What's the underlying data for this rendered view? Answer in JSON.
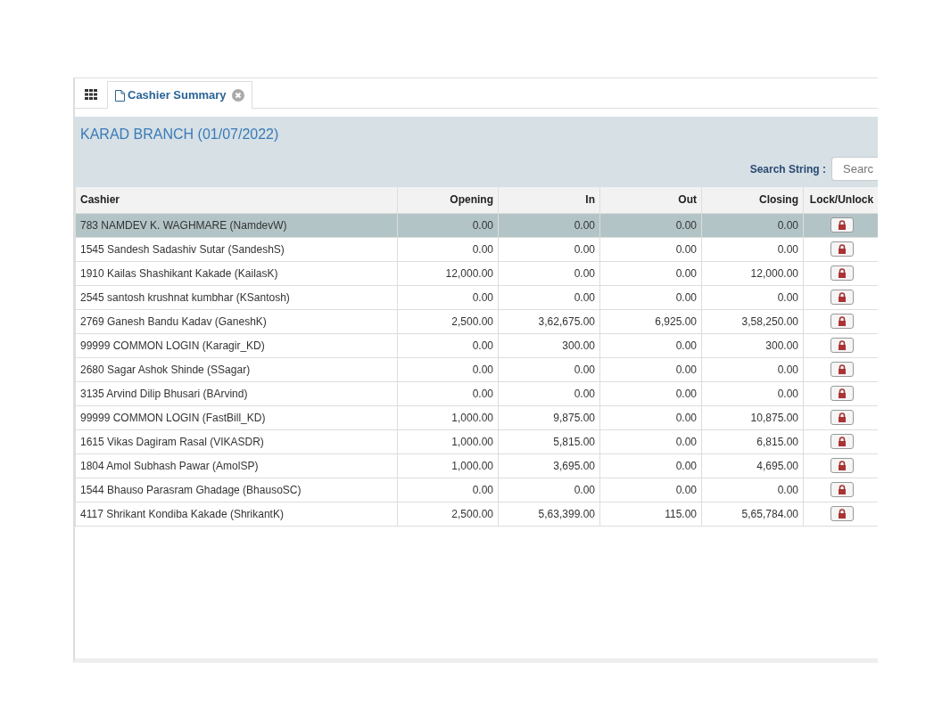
{
  "tabs": [
    {
      "label": "Cashier Summary",
      "selected": true
    }
  ],
  "title": "KARAD BRANCH (01/07/2022)",
  "search": {
    "label": "Search String :",
    "placeholder": "Searc"
  },
  "table": {
    "columns": [
      "Cashier",
      "Opening",
      "In",
      "Out",
      "Closing",
      "Lock/Unlock"
    ],
    "rows": [
      {
        "selected": true,
        "cells": [
          "783 NAMDEV K. WAGHMARE (NamdevW)",
          "0.00",
          "0.00",
          "0.00",
          "0.00"
        ]
      },
      {
        "selected": false,
        "cells": [
          "1545 Sandesh Sadashiv Sutar (SandeshS)",
          "0.00",
          "0.00",
          "0.00",
          "0.00"
        ]
      },
      {
        "selected": false,
        "cells": [
          "1910 Kailas Shashikant Kakade (KailasK)",
          "12,000.00",
          "0.00",
          "0.00",
          "12,000.00"
        ]
      },
      {
        "selected": false,
        "cells": [
          "2545 santosh krushnat kumbhar (KSantosh)",
          "0.00",
          "0.00",
          "0.00",
          "0.00"
        ]
      },
      {
        "selected": false,
        "cells": [
          "2769 Ganesh Bandu Kadav (GaneshK)",
          "2,500.00",
          "3,62,675.00",
          "6,925.00",
          "3,58,250.00"
        ]
      },
      {
        "selected": false,
        "cells": [
          "99999 COMMON LOGIN (Karagir_KD)",
          "0.00",
          "300.00",
          "0.00",
          "300.00"
        ]
      },
      {
        "selected": false,
        "cells": [
          "2680 Sagar Ashok Shinde (SSagar)",
          "0.00",
          "0.00",
          "0.00",
          "0.00"
        ]
      },
      {
        "selected": false,
        "cells": [
          "3135 Arvind Dilip Bhusari (BArvind)",
          "0.00",
          "0.00",
          "0.00",
          "0.00"
        ]
      },
      {
        "selected": false,
        "cells": [
          "99999 COMMON LOGIN (FastBill_KD)",
          "1,000.00",
          "9,875.00",
          "0.00",
          "10,875.00"
        ]
      },
      {
        "selected": false,
        "cells": [
          "1615 Vikas Dagiram Rasal (VIKASDR)",
          "1,000.00",
          "5,815.00",
          "0.00",
          "6,815.00"
        ]
      },
      {
        "selected": false,
        "cells": [
          "1804 Amol Subhash Pawar (AmolSP)",
          "1,000.00",
          "3,695.00",
          "0.00",
          "4,695.00"
        ]
      },
      {
        "selected": false,
        "cells": [
          "1544 Bhauso Parasram Ghadage (BhausoSC)",
          "0.00",
          "0.00",
          "0.00",
          "0.00"
        ]
      },
      {
        "selected": false,
        "cells": [
          "4117 Shrikant Kondiba Kakade (ShrikantK)",
          "2,500.00",
          "5,63,399.00",
          "115.00",
          "5,65,784.00"
        ]
      }
    ]
  }
}
